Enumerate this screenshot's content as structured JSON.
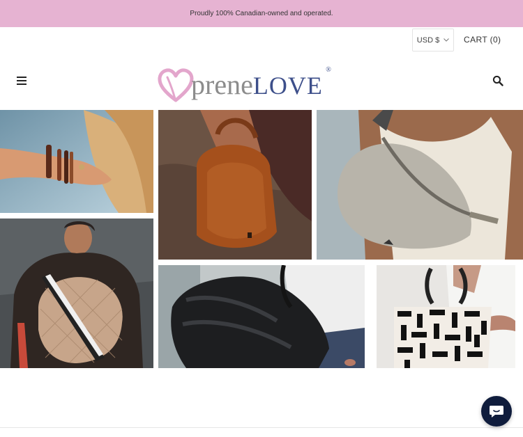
{
  "announcement": {
    "text": "Proudly 100% Canadian-owned and operated."
  },
  "topbar": {
    "currency": {
      "label": "USD $",
      "icon": "chevron-down-icon"
    },
    "cart": {
      "label": "CART (0)"
    }
  },
  "header": {
    "menu_icon": "hamburger-menu-icon",
    "search_icon": "search-icon",
    "logo": {
      "prene": "prene",
      "love": "LOVE",
      "reg": "®"
    }
  },
  "gallery": {
    "tiles": [
      {
        "name": "bracelets-photo"
      },
      {
        "name": "brown-leather-tote-photo"
      },
      {
        "name": "grey-belt-bag-photo"
      },
      {
        "name": "quilted-beige-bag-photo"
      },
      {
        "name": "black-puffer-bag-photo"
      },
      {
        "name": "black-white-print-tote-photo"
      }
    ]
  },
  "chat": {
    "icon": "chat-bubble-icon"
  },
  "colors": {
    "announcement_bg": "#e6b3d2",
    "logo_pink": "#e3a6cc",
    "logo_navy": "#3d4f8a",
    "chat_bg": "#0f1c3c"
  }
}
